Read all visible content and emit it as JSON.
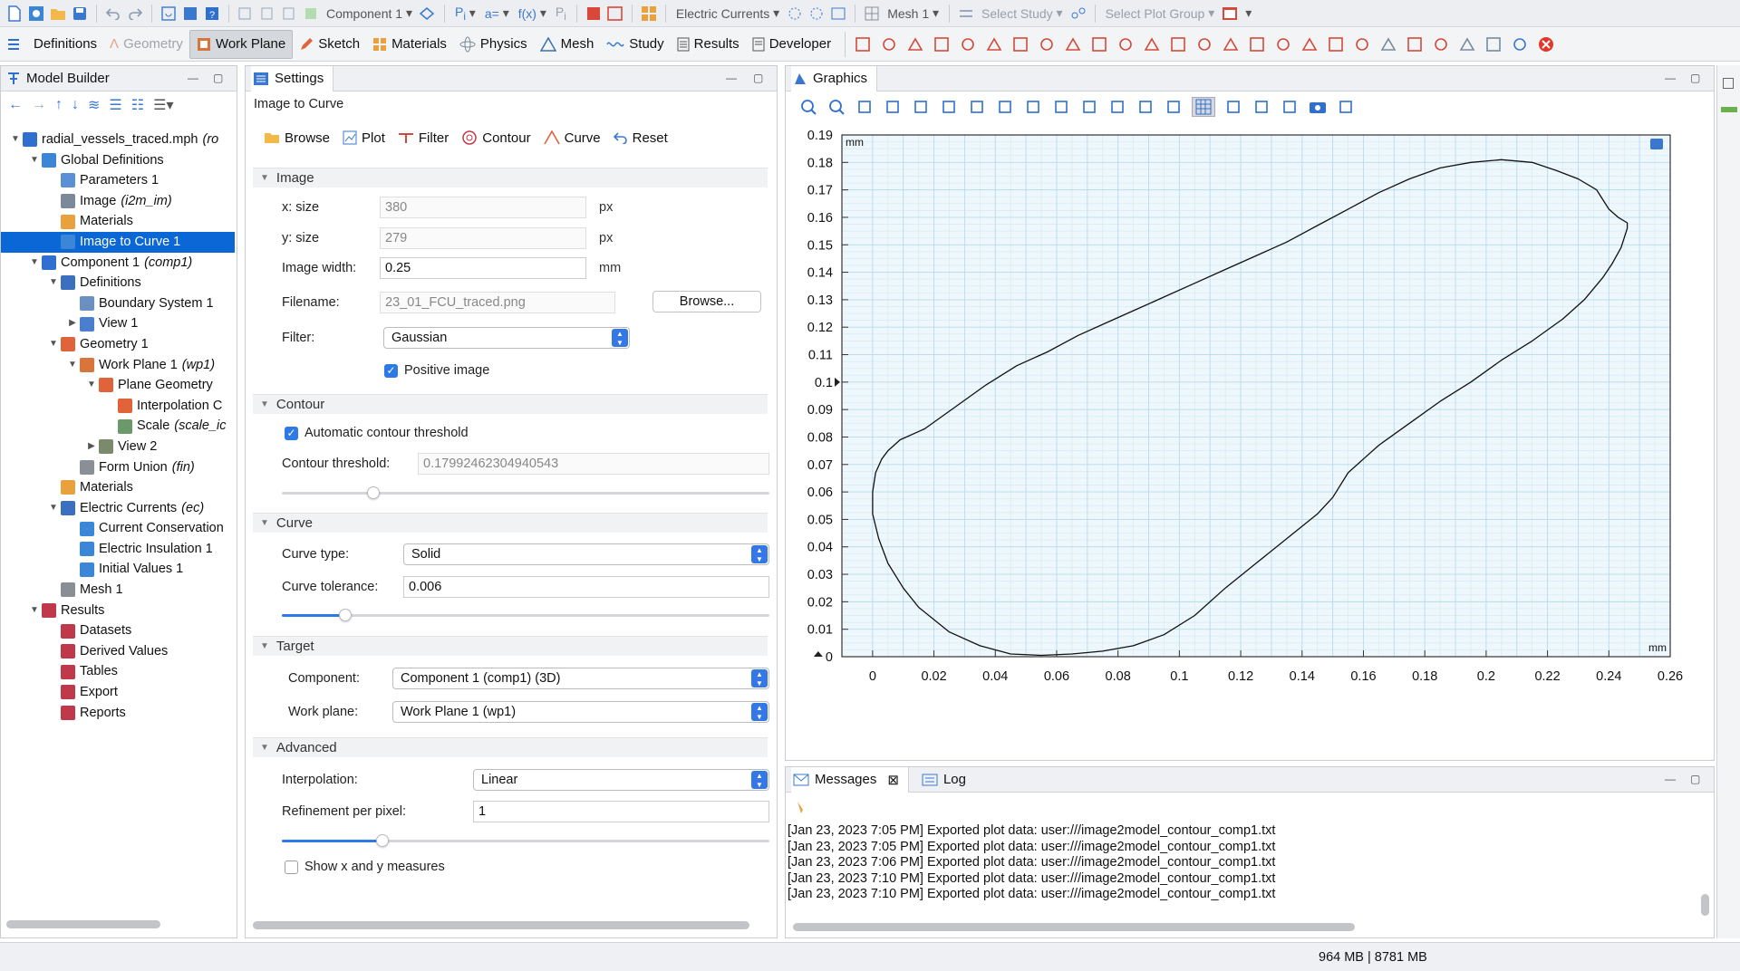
{
  "toolbar": {
    "component_dropdown": "Component 1",
    "physics_dropdown": "Electric Currents",
    "mesh_dropdown": "Mesh 1",
    "study_dropdown": "Select Study",
    "plotgroup_dropdown": "Select Plot Group"
  },
  "ribbon": {
    "tabs": [
      {
        "label": "Definitions"
      },
      {
        "label": "Geometry"
      },
      {
        "label": "Work Plane"
      },
      {
        "label": "Sketch"
      },
      {
        "label": "Materials"
      },
      {
        "label": "Physics"
      },
      {
        "label": "Mesh"
      },
      {
        "label": "Study"
      },
      {
        "label": "Results"
      },
      {
        "label": "Developer"
      }
    ]
  },
  "model_builder": {
    "title": "Model Builder",
    "tree": [
      {
        "label": "radial_vessels_traced.mph",
        "em": "(ro",
        "depth": 0,
        "tw": "▼",
        "icon": "#2f6fd0"
      },
      {
        "label": "Global Definitions",
        "em": "",
        "depth": 1,
        "tw": "▼",
        "icon": "#3b86d6"
      },
      {
        "label": "Parameters 1",
        "em": "",
        "depth": 2,
        "tw": "",
        "icon": "#5b8fd6"
      },
      {
        "label": "Image",
        "em": "(i2m_im)",
        "depth": 2,
        "tw": "",
        "icon": "#7a8a9a"
      },
      {
        "label": "Materials",
        "em": "",
        "depth": 2,
        "tw": "",
        "icon": "#e9a23b"
      },
      {
        "label": "Image to Curve 1",
        "em": "",
        "depth": 2,
        "tw": "",
        "icon": "#3b86d6",
        "sel": true
      },
      {
        "label": "Component 1",
        "em": "(comp1)",
        "depth": 1,
        "tw": "▼",
        "icon": "#2f6fd0"
      },
      {
        "label": "Definitions",
        "em": "",
        "depth": 2,
        "tw": "▼",
        "icon": "#3b6fc0"
      },
      {
        "label": "Boundary System 1",
        "em": "",
        "depth": 3,
        "tw": "",
        "icon": "#6a8fc0"
      },
      {
        "label": "View 1",
        "em": "",
        "depth": 3,
        "tw": "▶",
        "icon": "#4a7fd0"
      },
      {
        "label": "Geometry 1",
        "em": "",
        "depth": 2,
        "tw": "▼",
        "icon": "#e0633a"
      },
      {
        "label": "Work Plane 1",
        "em": "(wp1)",
        "depth": 3,
        "tw": "▼",
        "icon": "#d9743a"
      },
      {
        "label": "Plane Geometry",
        "em": "",
        "depth": 4,
        "tw": "▼",
        "icon": "#e0633a"
      },
      {
        "label": "Interpolation C",
        "em": "",
        "depth": 5,
        "tw": "",
        "icon": "#e0633a"
      },
      {
        "label": "Scale",
        "em": "(scale_ic",
        "depth": 5,
        "tw": "",
        "icon": "#6a9a6a"
      },
      {
        "label": "View 2",
        "em": "",
        "depth": 4,
        "tw": "▶",
        "icon": "#7a8a6a"
      },
      {
        "label": "Form Union",
        "em": "(fin)",
        "depth": 3,
        "tw": "",
        "icon": "#8a8f96"
      },
      {
        "label": "Materials",
        "em": "",
        "depth": 2,
        "tw": "",
        "icon": "#e9a23b"
      },
      {
        "label": "Electric Currents",
        "em": "(ec)",
        "depth": 2,
        "tw": "▼",
        "icon": "#3b6fc0"
      },
      {
        "label": "Current Conservation",
        "em": "",
        "depth": 3,
        "tw": "",
        "icon": "#3b86d6"
      },
      {
        "label": "Electric Insulation 1",
        "em": "",
        "depth": 3,
        "tw": "",
        "icon": "#3b86d6"
      },
      {
        "label": "Initial Values 1",
        "em": "",
        "depth": 3,
        "tw": "",
        "icon": "#3b86d6"
      },
      {
        "label": "Mesh 1",
        "em": "",
        "depth": 2,
        "tw": "",
        "icon": "#8a8f96"
      },
      {
        "label": "Results",
        "em": "",
        "depth": 1,
        "tw": "▼",
        "icon": "#c0394b"
      },
      {
        "label": "Datasets",
        "em": "",
        "depth": 2,
        "tw": "",
        "icon": "#c0394b"
      },
      {
        "label": "Derived Values",
        "em": "",
        "depth": 2,
        "tw": "",
        "icon": "#c0394b"
      },
      {
        "label": "Tables",
        "em": "",
        "depth": 2,
        "tw": "",
        "icon": "#c0394b"
      },
      {
        "label": "Export",
        "em": "",
        "depth": 2,
        "tw": "",
        "icon": "#c0394b"
      },
      {
        "label": "Reports",
        "em": "",
        "depth": 2,
        "tw": "",
        "icon": "#c0394b"
      }
    ]
  },
  "settings": {
    "title": "Settings",
    "subtitle": "Image to Curve",
    "actions": {
      "browse": "Browse",
      "plot": "Plot",
      "filter": "Filter",
      "contour": "Contour",
      "curve": "Curve",
      "reset": "Reset"
    },
    "image": {
      "section": "Image",
      "xsize_label": "x: size",
      "xsize": "380",
      "ysize_label": "y: size",
      "ysize": "279",
      "unit_px": "px",
      "width_label": "Image width:",
      "width": "0.25",
      "unit_mm": "mm",
      "filename_label": "Filename:",
      "filename": "23_01_FCU_traced.png",
      "browse_btn": "Browse...",
      "filter_label": "Filter:",
      "filter": "Gaussian",
      "positive_label": "Positive image"
    },
    "contour": {
      "section": "Contour",
      "auto_label": "Automatic contour threshold",
      "threshold_label": "Contour threshold:",
      "threshold": "0.17992462304940543"
    },
    "curve": {
      "section": "Curve",
      "type_label": "Curve type:",
      "type": "Solid",
      "tol_label": "Curve tolerance:",
      "tol": "0.006"
    },
    "target": {
      "section": "Target",
      "component_label": "Component:",
      "component": "Component 1 (comp1) (3D)",
      "workplane_label": "Work plane:",
      "workplane": "Work Plane 1 (wp1)"
    },
    "advanced": {
      "section": "Advanced",
      "interp_label": "Interpolation:",
      "interp": "Linear",
      "refine_label": "Refinement per pixel:",
      "refine": "1",
      "measures_label": "Show x and y measures"
    }
  },
  "graphics": {
    "title": "Graphics",
    "unit_label": "mm"
  },
  "chart_data": {
    "type": "line",
    "x_unit": "mm",
    "y_unit": "mm",
    "xlim": [
      -0.01,
      0.26
    ],
    "ylim": [
      0,
      0.19
    ],
    "xticks": [
      "0",
      "0.02",
      "0.04",
      "0.06",
      "0.08",
      "0.1",
      "0.12",
      "0.14",
      "0.16",
      "0.18",
      "0.2",
      "0.22",
      "0.24",
      "0.26"
    ],
    "yticks": [
      "0",
      "0.01",
      "0.02",
      "0.03",
      "0.04",
      "0.05",
      "0.06",
      "0.07",
      "0.08",
      "0.09",
      "0.1",
      "0.11",
      "0.12",
      "0.13",
      "0.14",
      "0.15",
      "0.16",
      "0.17",
      "0.18",
      "0.19"
    ],
    "grid": true,
    "series": [
      {
        "x": [
          0.005,
          0.009,
          0.017,
          0.027,
          0.037,
          0.047,
          0.057,
          0.067,
          0.077,
          0.087,
          0.095,
          0.105,
          0.115,
          0.125,
          0.135,
          0.145,
          0.155,
          0.165,
          0.175,
          0.185,
          0.195,
          0.205,
          0.215,
          0.223,
          0.23,
          0.236,
          0.24,
          0.243,
          0.246,
          0.246,
          0.244,
          0.241,
          0.238,
          0.232,
          0.225,
          0.215,
          0.205,
          0.195,
          0.185,
          0.175,
          0.165,
          0.16,
          0.155,
          0.15,
          0.145,
          0.135,
          0.125,
          0.115,
          0.105,
          0.095,
          0.085,
          0.075,
          0.065,
          0.055,
          0.045,
          0.035,
          0.025,
          0.015,
          0.01,
          0.005,
          0.002,
          0.0,
          0.0,
          0.001,
          0.003,
          0.005
        ],
        "y": [
          0.075,
          0.079,
          0.083,
          0.091,
          0.099,
          0.106,
          0.111,
          0.117,
          0.122,
          0.127,
          0.131,
          0.136,
          0.141,
          0.146,
          0.151,
          0.157,
          0.163,
          0.169,
          0.174,
          0.178,
          0.18,
          0.181,
          0.18,
          0.177,
          0.174,
          0.17,
          0.163,
          0.16,
          0.158,
          0.156,
          0.149,
          0.143,
          0.138,
          0.13,
          0.123,
          0.115,
          0.108,
          0.1,
          0.093,
          0.085,
          0.077,
          0.072,
          0.067,
          0.058,
          0.052,
          0.043,
          0.034,
          0.025,
          0.015,
          0.008,
          0.004,
          0.002,
          0.001,
          0.0005,
          0.001,
          0.004,
          0.009,
          0.018,
          0.025,
          0.034,
          0.043,
          0.052,
          0.06,
          0.067,
          0.072,
          0.075
        ]
      }
    ]
  },
  "messages": {
    "tab_messages": "Messages",
    "tab_log": "Log",
    "lines": [
      "[Jan 23, 2023 7:05 PM] Exported plot data: user:///image2model_contour_comp1.txt",
      "[Jan 23, 2023 7:05 PM] Exported plot data: user:///image2model_contour_comp1.txt",
      "[Jan 23, 2023 7:06 PM] Exported plot data: user:///image2model_contour_comp1.txt",
      "[Jan 23, 2023 7:10 PM] Exported plot data: user:///image2model_contour_comp1.txt",
      "[Jan 23, 2023 7:10 PM] Exported plot data: user:///image2model_contour_comp1.txt"
    ]
  },
  "status": {
    "memory": "964 MB | 8781 MB"
  }
}
